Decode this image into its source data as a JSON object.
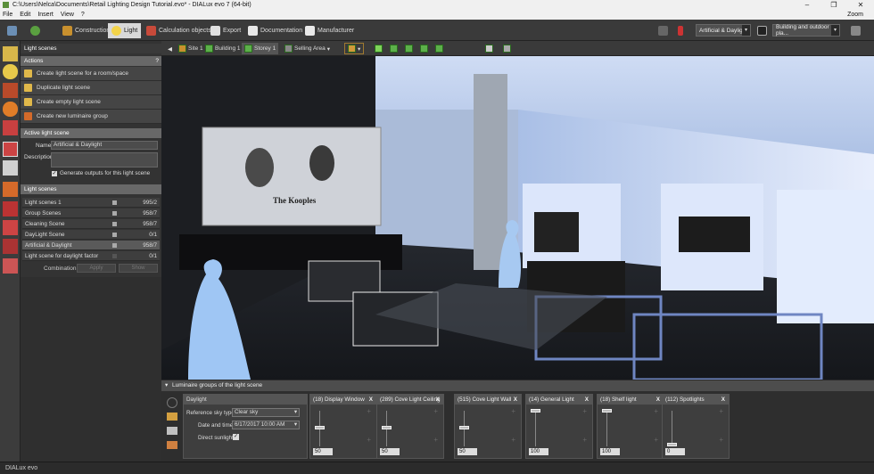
{
  "window": {
    "title": "C:\\Users\\Nelca\\Documents\\Retail Lighting Design Tutorial.evo* - DIALux evo 7  (64-bit)",
    "min": "–",
    "max": "❐",
    "close": "✕"
  },
  "menu": {
    "items": [
      "File",
      "Edit",
      "Insert",
      "View",
      "?"
    ],
    "zoom": "Zoom"
  },
  "toolbar": {
    "construction": "Construction",
    "light": "Light",
    "calc": "Calculation objects",
    "export": "Export",
    "documentation": "Documentation",
    "manufacturer": "Manufacturer",
    "scene_combo": "Artificial & Daylight",
    "view_combo": "Building and outdoor pla..."
  },
  "viewbar": {
    "site": "Site 1",
    "building": "Building 1",
    "storey": "Storey 1",
    "area": "Selling Area"
  },
  "panel": {
    "title": "Light scenes",
    "actions_hdr": "Actions",
    "help": "?",
    "actions": [
      "Create light scene for a room/space",
      "Duplicate light scene",
      "Create empty light scene",
      "Create new luminaire group"
    ],
    "active_hdr": "Active light scene",
    "name_label": "Name",
    "name_value": "Artificial & Daylight",
    "desc_label": "Description",
    "generate_label": "Generate outputs for this light scene",
    "scenes_hdr": "Light scenes",
    "scenes": [
      {
        "name": "Light scenes 1",
        "count": "995/2"
      },
      {
        "name": "Group Scenes",
        "count": "958/7"
      },
      {
        "name": "Cleaning Scene",
        "count": "958/7"
      },
      {
        "name": "DayLight Scene",
        "count": "0/1"
      },
      {
        "name": "Artificial & Daylight",
        "count": "958/7"
      },
      {
        "name": "Light scene for daylight factor",
        "count": "0/1"
      }
    ],
    "combination_label": "Combination",
    "apply": "Apply",
    "show": "Show"
  },
  "viewport": {
    "poster_text": "The Kooples"
  },
  "bottom": {
    "header": "Luminaire groups of the light scene",
    "daylight": {
      "title": "Daylight",
      "sky_label": "Reference sky type",
      "sky_value": "Clear sky",
      "date_label": "Date and time",
      "date_value": "6/17/2017 10:00 AM",
      "direct_label": "Direct sunlight"
    },
    "groups": [
      {
        "name": "(18)  Display Window",
        "value": "50",
        "level": 0.5
      },
      {
        "name": "(289)  Cove Light Ceiling",
        "value": "50",
        "level": 0.5
      },
      {
        "name": "(515)  Cove Light Wall",
        "value": "50",
        "level": 0.5
      },
      {
        "name": "(14)  General Light",
        "value": "100",
        "level": 1.0
      },
      {
        "name": "(18)  Shelf light",
        "value": "100",
        "level": 1.0
      },
      {
        "name": "(112)  Spotlights",
        "value": "0",
        "level": 0.0
      }
    ]
  },
  "status": {
    "brand": "DIALux evo"
  }
}
